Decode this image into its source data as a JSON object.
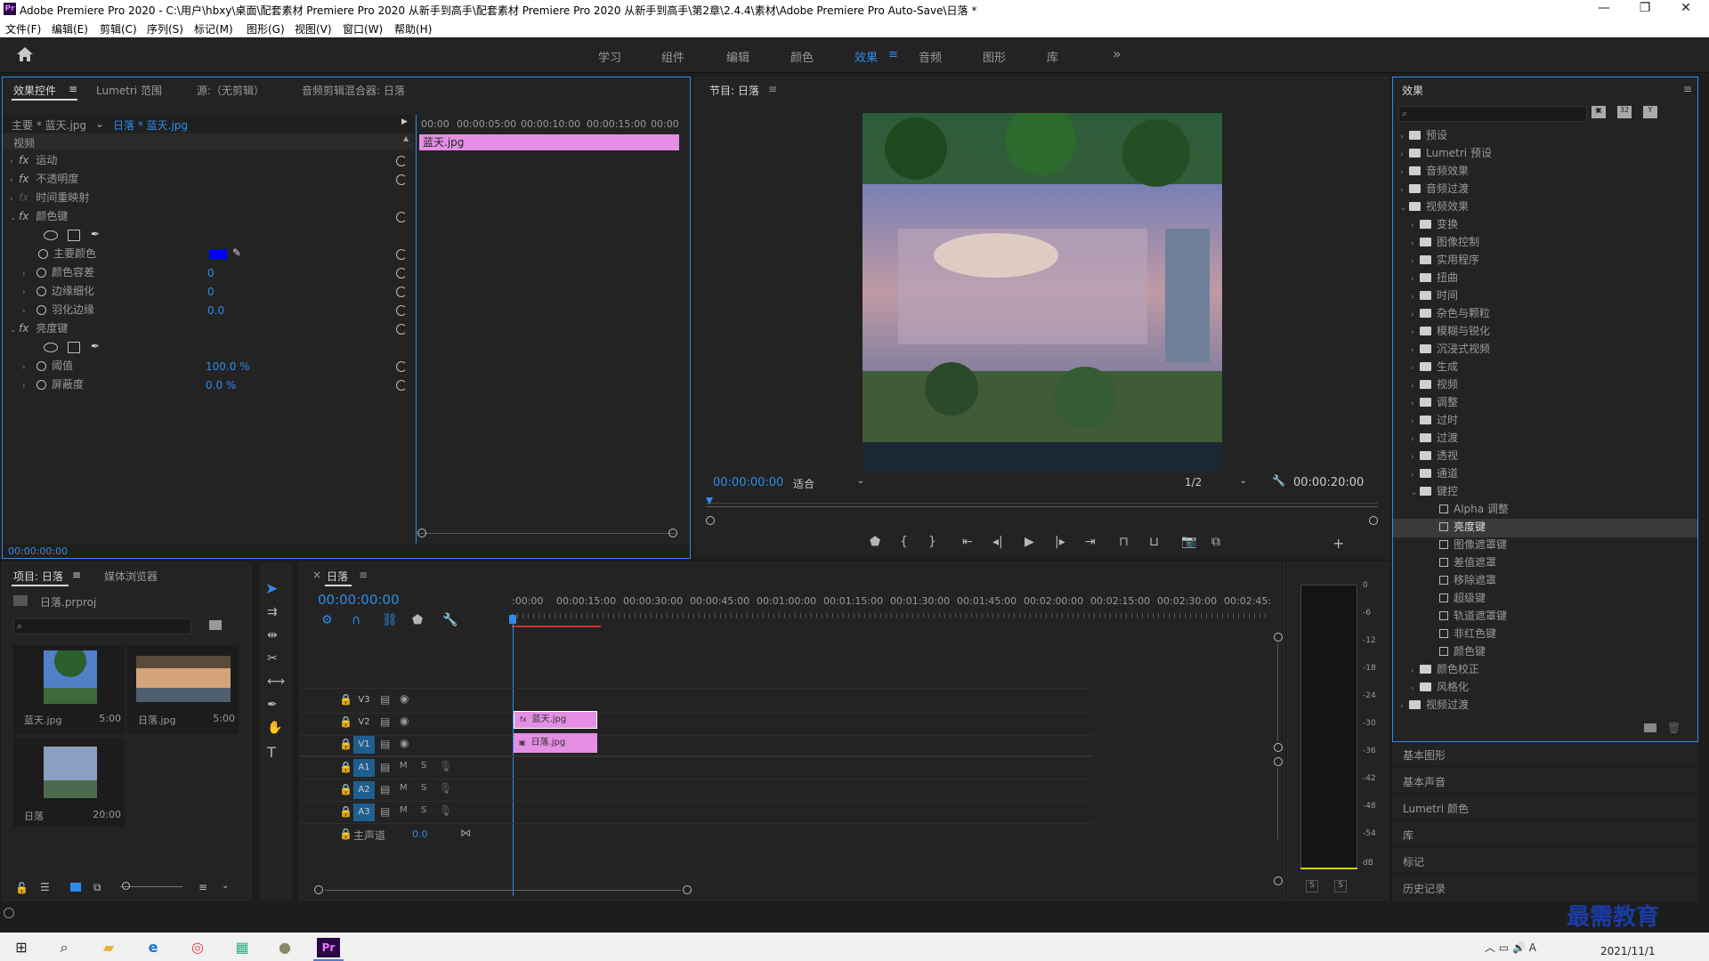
{
  "window": {
    "app_title": "Adobe Premiere Pro 2020 - C:\\用户\\hbxy\\桌面\\配套素材 Premiere Pro 2020 从新手到高手\\配套素材 Premiere Pro 2020 从新手到高手\\第2章\\2.4.4\\素材\\Adobe Premiere Pro Auto-Save\\日落 *",
    "logo": "Pr",
    "min": "—",
    "max": "❐",
    "close": "✕"
  },
  "menu": [
    "文件(F)",
    "编辑(E)",
    "剪辑(C)",
    "序列(S)",
    "标记(M)",
    "图形(G)",
    "视图(V)",
    "窗口(W)",
    "帮助(H)"
  ],
  "workspaces": {
    "items": [
      "学习",
      "组件",
      "编辑",
      "颜色",
      "效果",
      "音频",
      "图形",
      "库"
    ],
    "active": "效果",
    "more": "»",
    "menu": "≡"
  },
  "effect_controls": {
    "tabs": [
      "效果控件",
      "Lumetri 范围",
      "源:（无剪辑）",
      "音频剪辑混合器: 日落"
    ],
    "tab_menu": "≡",
    "master": "主要 * 蓝天.jpg",
    "clip": "日落 * 蓝天.jpg",
    "ruler": [
      "00:00",
      "00:00:05:00",
      "00:00:10:00",
      "00:00:15:00",
      "00:00"
    ],
    "clip_bar": "蓝天.jpg",
    "section": "视频",
    "rows": [
      {
        "label": "运动",
        "fx": "fx"
      },
      {
        "label": "不透明度",
        "fx": "fx"
      },
      {
        "label": "时间重映射",
        "fx": ""
      },
      {
        "label": "颜色键",
        "fx": "fx"
      },
      {
        "label": "主要颜色",
        "value": ""
      },
      {
        "label": "颜色容差",
        "value": "0"
      },
      {
        "label": "边缘细化",
        "value": "0"
      },
      {
        "label": "羽化边缘",
        "value": "0.0"
      },
      {
        "label": "亮度键",
        "fx": "fx"
      },
      {
        "label": "阈值",
        "value": "100.0 %"
      },
      {
        "label": "屏蔽度",
        "value": "0.0 %"
      }
    ],
    "key_color": "#0000ff",
    "timecode": "00:00:00:00"
  },
  "program": {
    "title": "节目: 日落",
    "menu": "≡",
    "timecode": "00:00:00:00",
    "fit": "适合",
    "res": "1/2",
    "duration": "00:00:20:00"
  },
  "effects": {
    "title": "效果",
    "menu": "≡",
    "search_placeholder": "",
    "tree": [
      {
        "label": "预设",
        "level": 0,
        "open": false
      },
      {
        "label": "Lumetri 预设",
        "level": 0,
        "open": false
      },
      {
        "label": "音频效果",
        "level": 0,
        "open": false
      },
      {
        "label": "音频过渡",
        "level": 0,
        "open": false
      },
      {
        "label": "视频效果",
        "level": 0,
        "open": true
      },
      {
        "label": "变换",
        "level": 1,
        "open": false
      },
      {
        "label": "图像控制",
        "level": 1,
        "open": false
      },
      {
        "label": "实用程序",
        "level": 1,
        "open": false
      },
      {
        "label": "扭曲",
        "level": 1,
        "open": false
      },
      {
        "label": "时间",
        "level": 1,
        "open": false
      },
      {
        "label": "杂色与颗粒",
        "level": 1,
        "open": false
      },
      {
        "label": "模糊与锐化",
        "level": 1,
        "open": false
      },
      {
        "label": "沉浸式视频",
        "level": 1,
        "open": false
      },
      {
        "label": "生成",
        "level": 1,
        "open": false
      },
      {
        "label": "视频",
        "level": 1,
        "open": false
      },
      {
        "label": "调整",
        "level": 1,
        "open": false
      },
      {
        "label": "过时",
        "level": 1,
        "open": false
      },
      {
        "label": "过渡",
        "level": 1,
        "open": false
      },
      {
        "label": "透视",
        "level": 1,
        "open": false
      },
      {
        "label": "通道",
        "level": 1,
        "open": false
      },
      {
        "label": "键控",
        "level": 1,
        "open": true
      },
      {
        "label": "Alpha 调整",
        "level": 2
      },
      {
        "label": "亮度键",
        "level": 2,
        "selected": true
      },
      {
        "label": "图像遮罩键",
        "level": 2
      },
      {
        "label": "差值遮罩",
        "level": 2
      },
      {
        "label": "移除遮罩",
        "level": 2
      },
      {
        "label": "超级键",
        "level": 2
      },
      {
        "label": "轨道遮罩键",
        "level": 2
      },
      {
        "label": "非红色键",
        "level": 2
      },
      {
        "label": "颜色键",
        "level": 2
      },
      {
        "label": "颜色校正",
        "level": 1,
        "open": false
      },
      {
        "label": "风格化",
        "level": 1,
        "open": false
      },
      {
        "label": "视频过渡",
        "level": 0,
        "open": false
      }
    ],
    "collapsed_panels": [
      "基本图形",
      "基本声音",
      "Lumetri 颜色",
      "库",
      "标记",
      "历史记录"
    ]
  },
  "project": {
    "tabs": [
      "项目: 日落",
      "媒体浏览器"
    ],
    "menu": "≡",
    "file": "日落.prproj",
    "items": [
      {
        "name": "蓝天.jpg",
        "dur": "5:00"
      },
      {
        "name": "日落.jpg",
        "dur": "5:00"
      },
      {
        "name": "日落",
        "dur": "20:00"
      }
    ]
  },
  "timeline": {
    "title": "日落",
    "menu": "≡",
    "close": "×",
    "timecode": "00:00:00:00",
    "ruler": [
      ":00:00",
      "00:00:15:00",
      "00:00:30:00",
      "00:00:45:00",
      "00:01:00:00",
      "00:01:15:00",
      "00:01:30:00",
      "00:01:45:00",
      "00:02:00:00",
      "00:02:15:00",
      "00:02:30:00",
      "00:02:45:"
    ],
    "video_tracks": [
      "V3",
      "V2",
      "V1"
    ],
    "audio_tracks": [
      "A1",
      "A2",
      "A3"
    ],
    "master": "主声道",
    "master_val": "0.0",
    "clips": [
      {
        "track": "V2",
        "label": "蓝天.jpg"
      },
      {
        "track": "V1",
        "label": "日落.jpg"
      }
    ],
    "m": "M",
    "s": "S"
  },
  "meter": {
    "scale": [
      "0",
      "-6",
      "-12",
      "-18",
      "-24",
      "-30",
      "-36",
      "-42",
      "-48",
      "-54",
      "dB"
    ],
    "solo": [
      "S",
      "S"
    ]
  },
  "taskbar": {
    "date": "2021/11/1",
    "watermark": "最需教育"
  }
}
